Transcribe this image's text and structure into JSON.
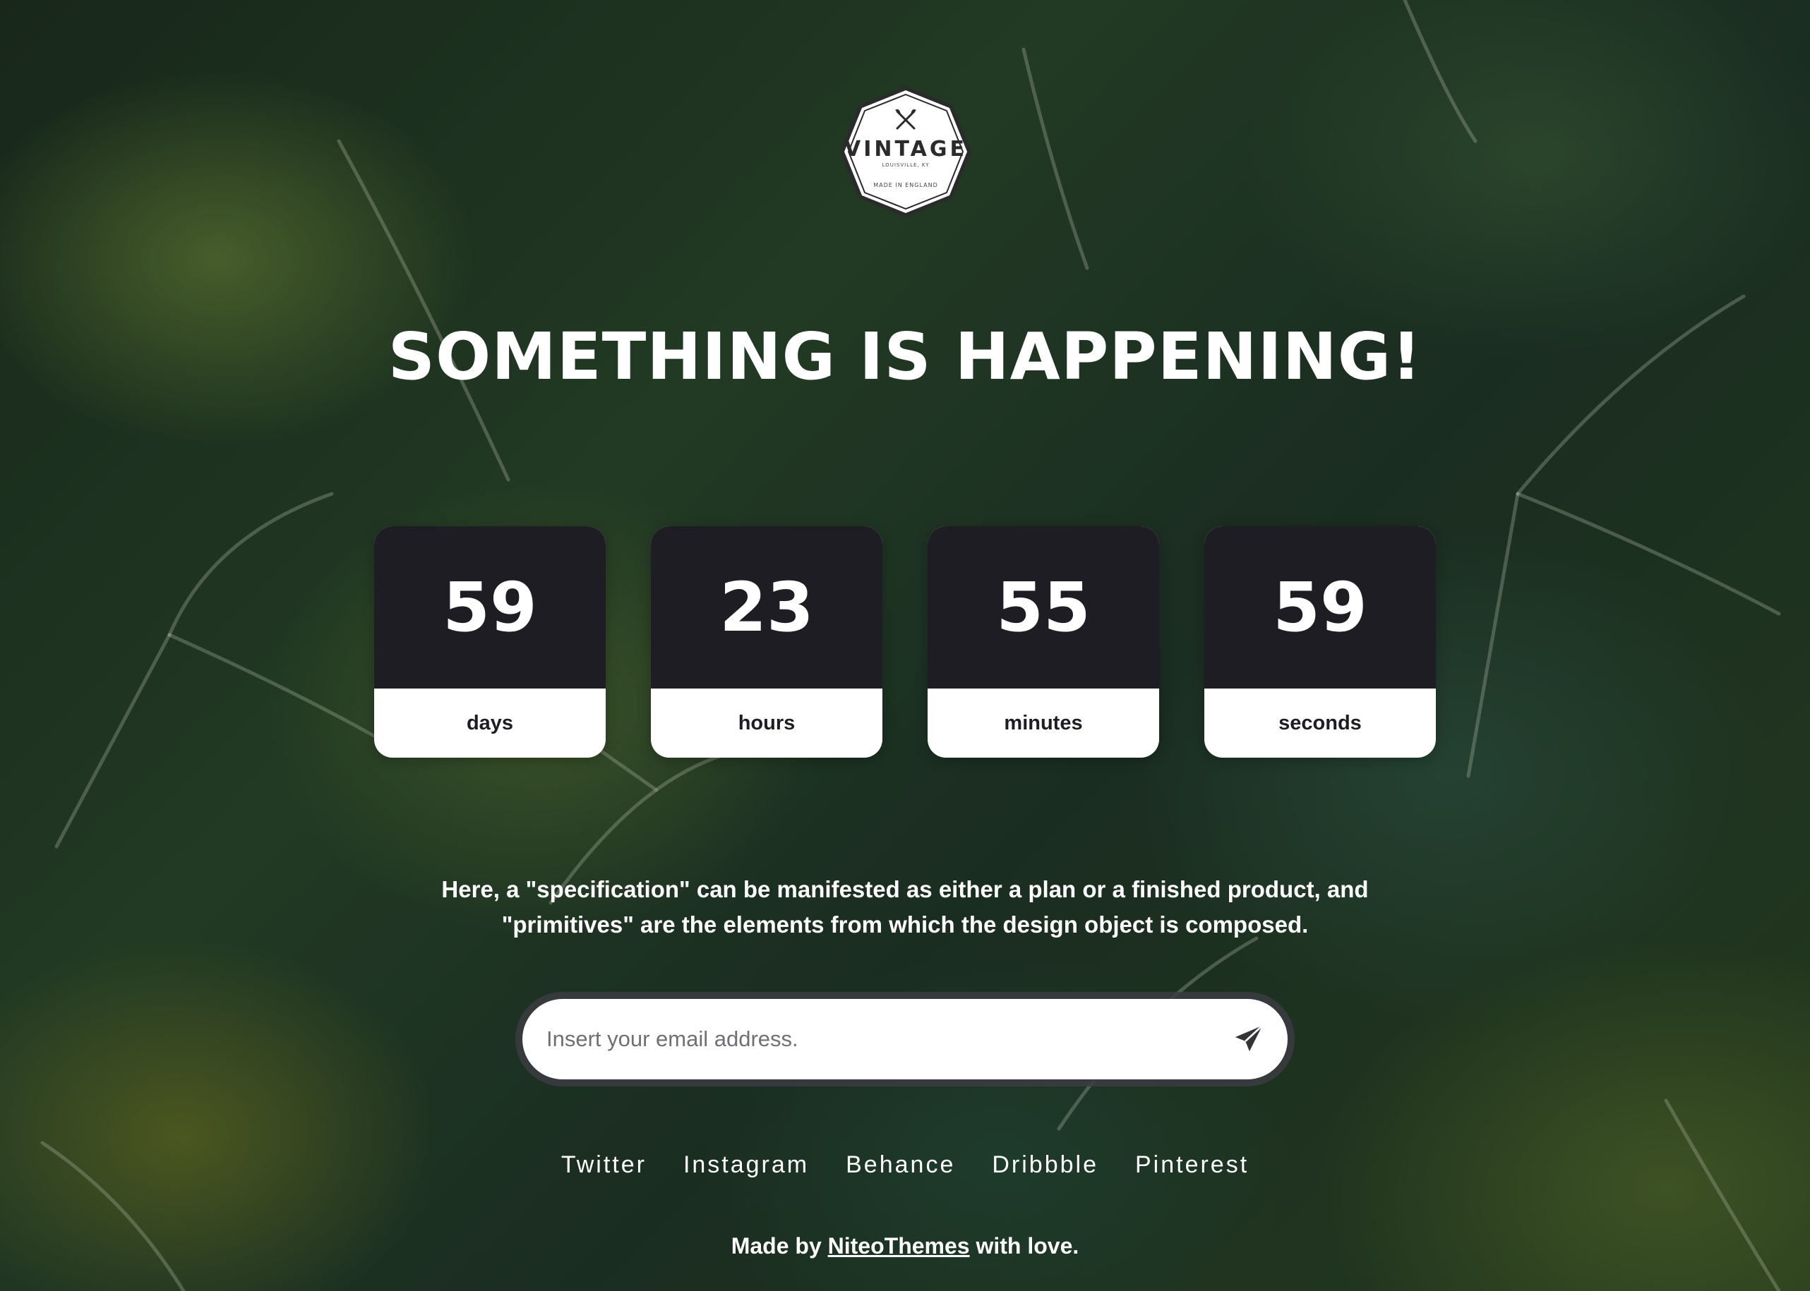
{
  "logo": {
    "text": "VINTAGE",
    "subtext": "LOUISVILLE, KY",
    "tagline": "MADE IN ENGLAND",
    "icon": "crossed-axes-icon"
  },
  "headline": "SOMETHING IS HAPPENING!",
  "countdown": [
    {
      "value": "59",
      "label": "days"
    },
    {
      "value": "23",
      "label": "hours"
    },
    {
      "value": "55",
      "label": "minutes"
    },
    {
      "value": "59",
      "label": "seconds"
    }
  ],
  "description": "Here, a \"specification\" can be manifested as either a plan or a finished product, and \"primitives\" are the elements from which the design object is composed.",
  "subscribe": {
    "placeholder": "Insert your email address.",
    "value": "",
    "button_icon": "paper-plane-icon"
  },
  "social": [
    "Twitter",
    "Instagram",
    "Behance",
    "Dribbble",
    "Pinterest"
  ],
  "footer": {
    "prefix": "Made by",
    "link_text": "NiteoThemes",
    "suffix": "with love."
  },
  "colors": {
    "countdown_dark": "#1f1d24",
    "countdown_light": "#ffffff",
    "text": "#ffffff"
  }
}
